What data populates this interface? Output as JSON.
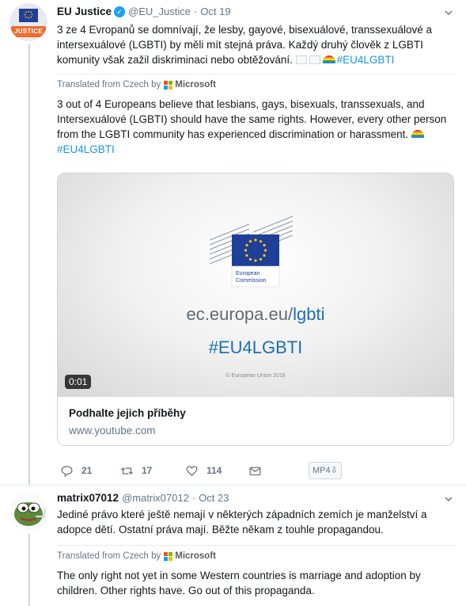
{
  "tweet1": {
    "avatar_label": "JUSTICE",
    "display_name": "EU Justice",
    "handle": "@EU_Justice",
    "dot": "·",
    "time": "Oct 19",
    "text_main": "3 ze 4 Evropanů se domnívají, že lesby, gayové, bisexuálové, transsexuálové a intersexuálové (LGBTI) by měli mít stejná práva. Každý druhý člověk z LGBTI komunity však zažil diskriminaci nebo obtěžování.",
    "hashtag": "#EU4LGBTI",
    "translated_prefix": "Translated from Czech by",
    "translator": "Microsoft",
    "translation_main": "3 out of 4 Europeans believe that lesbians, gays, bisexuals, transsexuals, and Intersexuálové (LGBTI) should have the same rights. However, every other person from the LGBTI community has experienced discrimination or harassment.",
    "translation_glyphs": "󠁿󠁿",
    "translation_hashtag": "#EU4LGBTI",
    "card": {
      "logo_line1": "European",
      "logo_line2": "Commission",
      "url_prefix": "ec.europa.eu/",
      "url_suffix": "lgbti",
      "hashtag": "#EU4LGBTI",
      "copyright": "© European Union 2018",
      "duration": "0:01",
      "title": "Podhalte jejich příběhy",
      "domain": "www.youtube.com"
    },
    "actions": {
      "replies": "21",
      "retweets": "17",
      "likes": "114",
      "mp4_label": "MP4"
    }
  },
  "tweet2": {
    "display_name": "matrix07012",
    "handle": "@matrix07012",
    "dot": "·",
    "time": "Oct 23",
    "text": "Jediné právo které ještě nemají v některých západních zemích je manželství a adopce dětí. Ostatní práva mají. Běžte někam z touhle propagandou.",
    "translated_prefix": "Translated from Czech by",
    "translator": "Microsoft",
    "translation": "The only right not yet in some Western countries is marriage and adoption by children. Other rights have. Go out of this propaganda."
  },
  "colors": {
    "link": "#1b95e0",
    "verified": "#1da1f2",
    "muted": "#657786",
    "eu_blue": "#1f3f99",
    "justice_orange": "#ef6a2e"
  },
  "icons": [
    "verified-icon",
    "caret-down-icon",
    "reply-icon",
    "retweet-icon",
    "like-icon",
    "dm-icon",
    "microsoft-logo-icon",
    "eu-flag-icon",
    "frog-avatar-icon",
    "rainbow-flag-icon",
    "white-flag-icon"
  ]
}
